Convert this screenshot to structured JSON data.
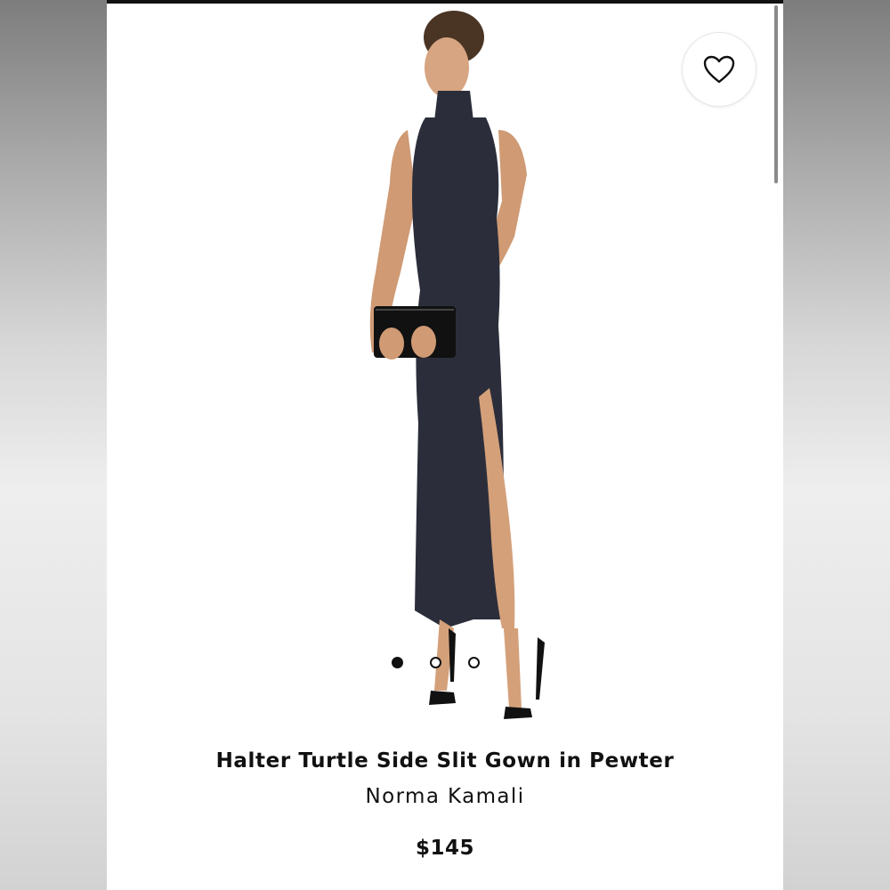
{
  "product": {
    "title": "Halter Turtle Side Slit Gown in Pewter",
    "brand": "Norma Kamali",
    "price": "$145"
  },
  "gallery": {
    "image_count": 3,
    "active_index": 0
  },
  "icons": {
    "favorite": "heart-outline-icon"
  },
  "colors": {
    "dress": "#2b2e3a",
    "text": "#111111",
    "background": "#ffffff"
  }
}
